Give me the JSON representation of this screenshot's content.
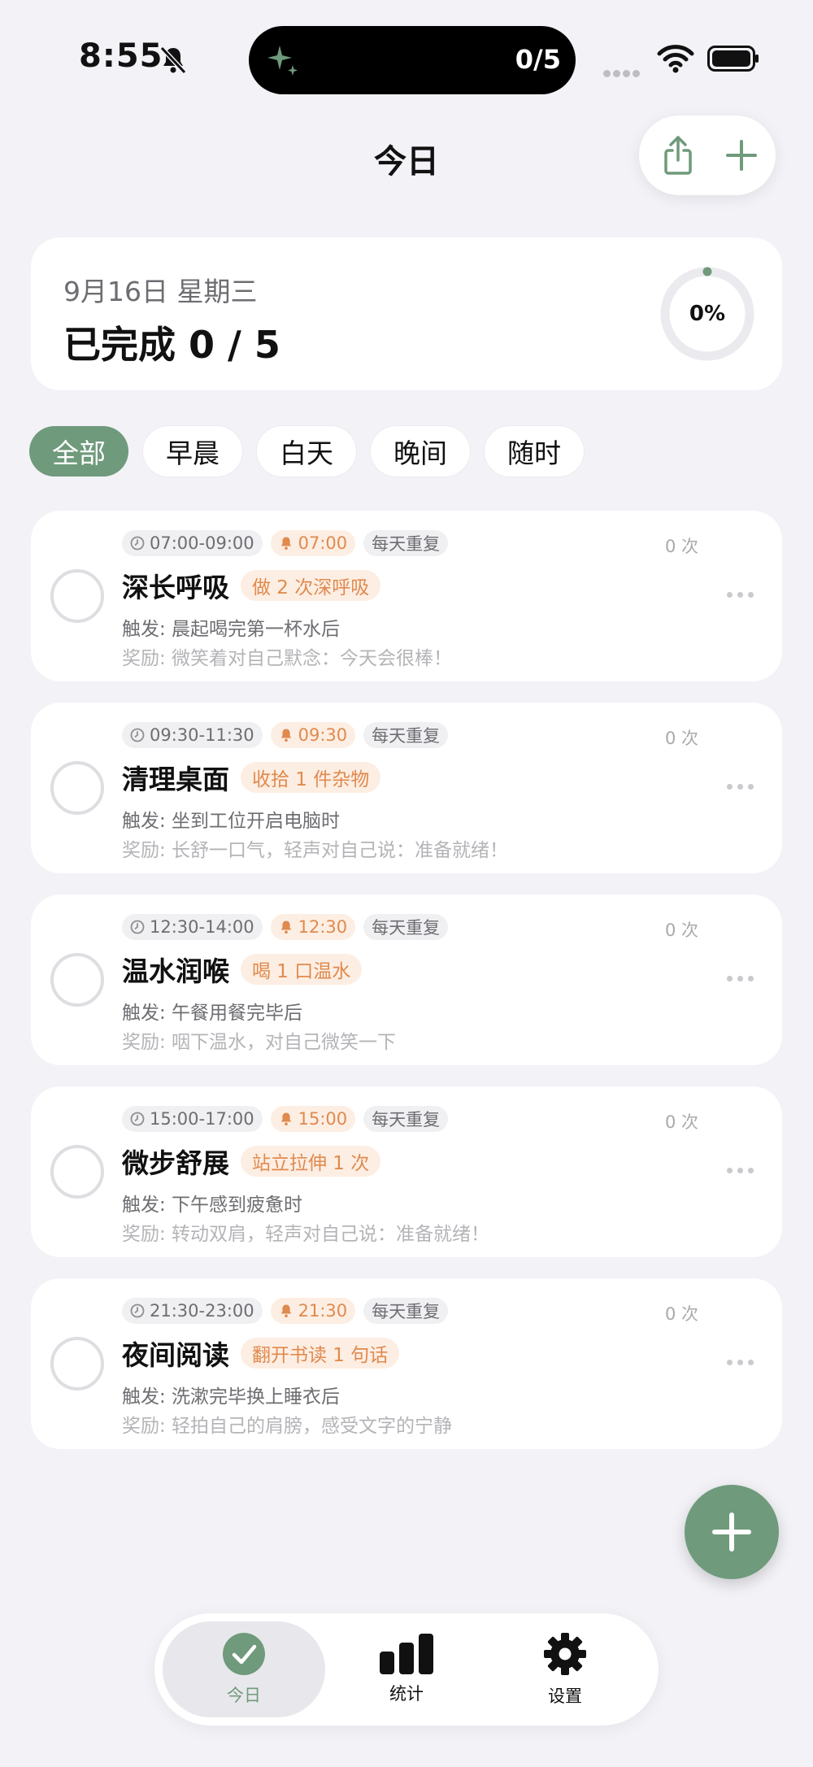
{
  "status_bar": {
    "time": "8:55",
    "island_count": "0/5"
  },
  "nav": {
    "title": "今日"
  },
  "summary": {
    "date": "9月16日 星期三",
    "done_text": "已完成 0 / 5",
    "percent_label": "0%",
    "progress": 0
  },
  "filters": [
    "全部",
    "早晨",
    "白天",
    "晚间",
    "随时"
  ],
  "tasks": [
    {
      "time": "07:00-09:00",
      "alarm": "07:00",
      "repeat": "每天重复",
      "count": "0 次",
      "title": "深长呼吸",
      "badge": "做 2 次深呼吸",
      "trigger": "触发: 晨起喝完第一杯水后",
      "reward": "奖励: 微笑着对自己默念：今天会很棒！"
    },
    {
      "time": "09:30-11:30",
      "alarm": "09:30",
      "repeat": "每天重复",
      "count": "0 次",
      "title": "清理桌面",
      "badge": "收拾 1 件杂物",
      "trigger": "触发: 坐到工位开启电脑时",
      "reward": "奖励: 长舒一口气，轻声对自己说：准备就绪！"
    },
    {
      "time": "12:30-14:00",
      "alarm": "12:30",
      "repeat": "每天重复",
      "count": "0 次",
      "title": "温水润喉",
      "badge": "喝 1 口温水",
      "trigger": "触发: 午餐用餐完毕后",
      "reward": "奖励: 咽下温水，对自己微笑一下"
    },
    {
      "time": "15:00-17:00",
      "alarm": "15:00",
      "repeat": "每天重复",
      "count": "0 次",
      "title": "微步舒展",
      "badge": "站立拉伸 1 次",
      "trigger": "触发: 下午感到疲惫时",
      "reward": "奖励: 转动双肩，轻声对自己说：准备就绪！"
    },
    {
      "time": "21:30-23:00",
      "alarm": "21:30",
      "repeat": "每天重复",
      "count": "0 次",
      "title": "夜间阅读",
      "badge": "翻开书读 1 句话",
      "trigger": "触发: 洗漱完毕换上睡衣后",
      "reward": "奖励: 轻拍自己的肩膀，感受文字的宁静"
    }
  ],
  "tabbar": {
    "today": "今日",
    "stats": "统计",
    "settings": "设置"
  },
  "colors": {
    "accent": "#6f9a7b",
    "orange": "#e08a4e",
    "background": "#f2f2f7"
  }
}
